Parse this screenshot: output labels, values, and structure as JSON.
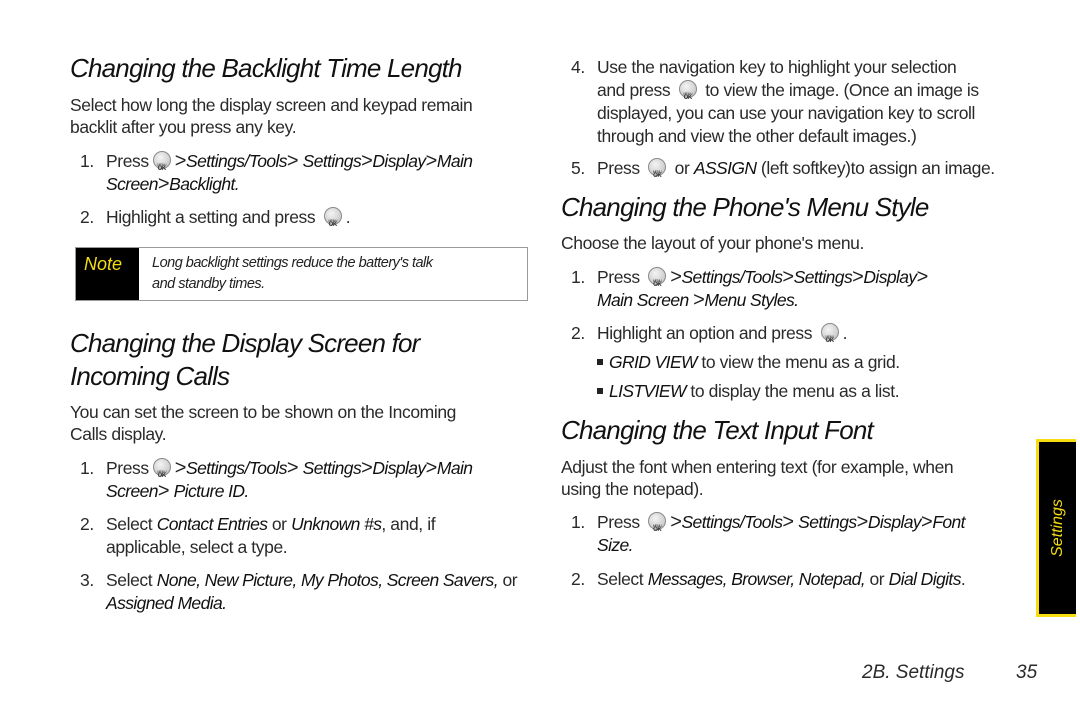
{
  "left": {
    "s1": {
      "heading": "Changing the Backlight Time Length",
      "intro_1": "Select how long the display screen and keypad remain",
      "intro_2": "backlit after you press any key.",
      "step1": {
        "num": "1.",
        "pre": "Press",
        "path_1": "Settings/Tools",
        "path_2": "Settings",
        "path_3": "Display",
        "path_4": "Main",
        "line2_a": "Screen",
        "line2_b": "Backlight."
      },
      "step2": {
        "num": "2.",
        "text": "Highlight a setting and press",
        "end": "."
      },
      "note": {
        "label": "Note",
        "line1": "Long backlight settings reduce the battery's talk",
        "line2": "and standby times."
      }
    },
    "s2": {
      "heading_1": "Changing the Display Screen for",
      "heading_2": "Incoming Calls",
      "intro_1": "You can set the screen to be shown on the Incoming",
      "intro_2": "Calls display.",
      "step1": {
        "num": "1.",
        "pre": "Press",
        "path_1": "Settings/Tools",
        "path_2": "Settings",
        "path_3": "Display",
        "path_4": "Main",
        "line2_a": "Screen",
        "line2_b": "Picture ID."
      },
      "step2": {
        "num": "2.",
        "pre": "Select",
        "opt1": "Contact Entries",
        "or": "or",
        "opt2": "Unknown #s",
        "post": ", and, if",
        "line2": "applicable, select a type."
      },
      "step3": {
        "num": "3.",
        "pre": "Select",
        "opts": "None, New Picture, My Photos, Screen Savers,",
        "or": "or",
        "line2": "Assigned Media."
      }
    }
  },
  "right": {
    "s2_cont": {
      "step4": {
        "num": "4.",
        "line1": "Use the navigation key to highlight your selection",
        "line2_pre": "and press",
        "line2_post": "to view the image. (Once an image is",
        "line3": "displayed, you can use your navigation key to scroll",
        "line4": "through and view the other default images.)"
      },
      "step5": {
        "num": "5.",
        "pre": "Press",
        "or": "or",
        "assign": "ASSIGN",
        "post": "(left softkey)to assign an image."
      }
    },
    "s3": {
      "heading": "Changing the Phone's Menu Style",
      "intro": "Choose the layout of your phone's menu.",
      "step1": {
        "num": "1.",
        "pre": "Press",
        "path_1": "Settings/Tools",
        "path_2": "Settings",
        "path_3": "Display",
        "line2_a": "Main Screen",
        "line2_b": "Menu Styles."
      },
      "step2": {
        "num": "2.",
        "text": "Highlight an option and press",
        "end": "."
      },
      "bullets": [
        {
          "term": "GRID VIEW",
          "text": "to view the menu as a grid."
        },
        {
          "term": "LISTVIEW",
          "text": "to display the menu as a list."
        }
      ]
    },
    "s4": {
      "heading": "Changing the Text Input Font",
      "intro_1": "Adjust the font when entering text (for example, when",
      "intro_2": "using the notepad).",
      "step1": {
        "num": "1.",
        "pre": "Press",
        "path_1": "Settings/Tools",
        "path_2": "Settings",
        "path_3": "Display",
        "path_4": "Font",
        "line2": "Size."
      },
      "step2": {
        "num": "2.",
        "pre": "Select",
        "opts": "Messages, Browser, Notepad,",
        "or": "or",
        "opt_last": "Dial Digits",
        "end": "."
      }
    }
  },
  "side_tab": {
    "label": "Settings",
    "bg": "#000000",
    "accent": "#f5dd11"
  },
  "footer": {
    "section": "2B. Settings",
    "page": "35"
  },
  "icons": {
    "key": "menu-ok-key-icon",
    "sep": ">"
  }
}
